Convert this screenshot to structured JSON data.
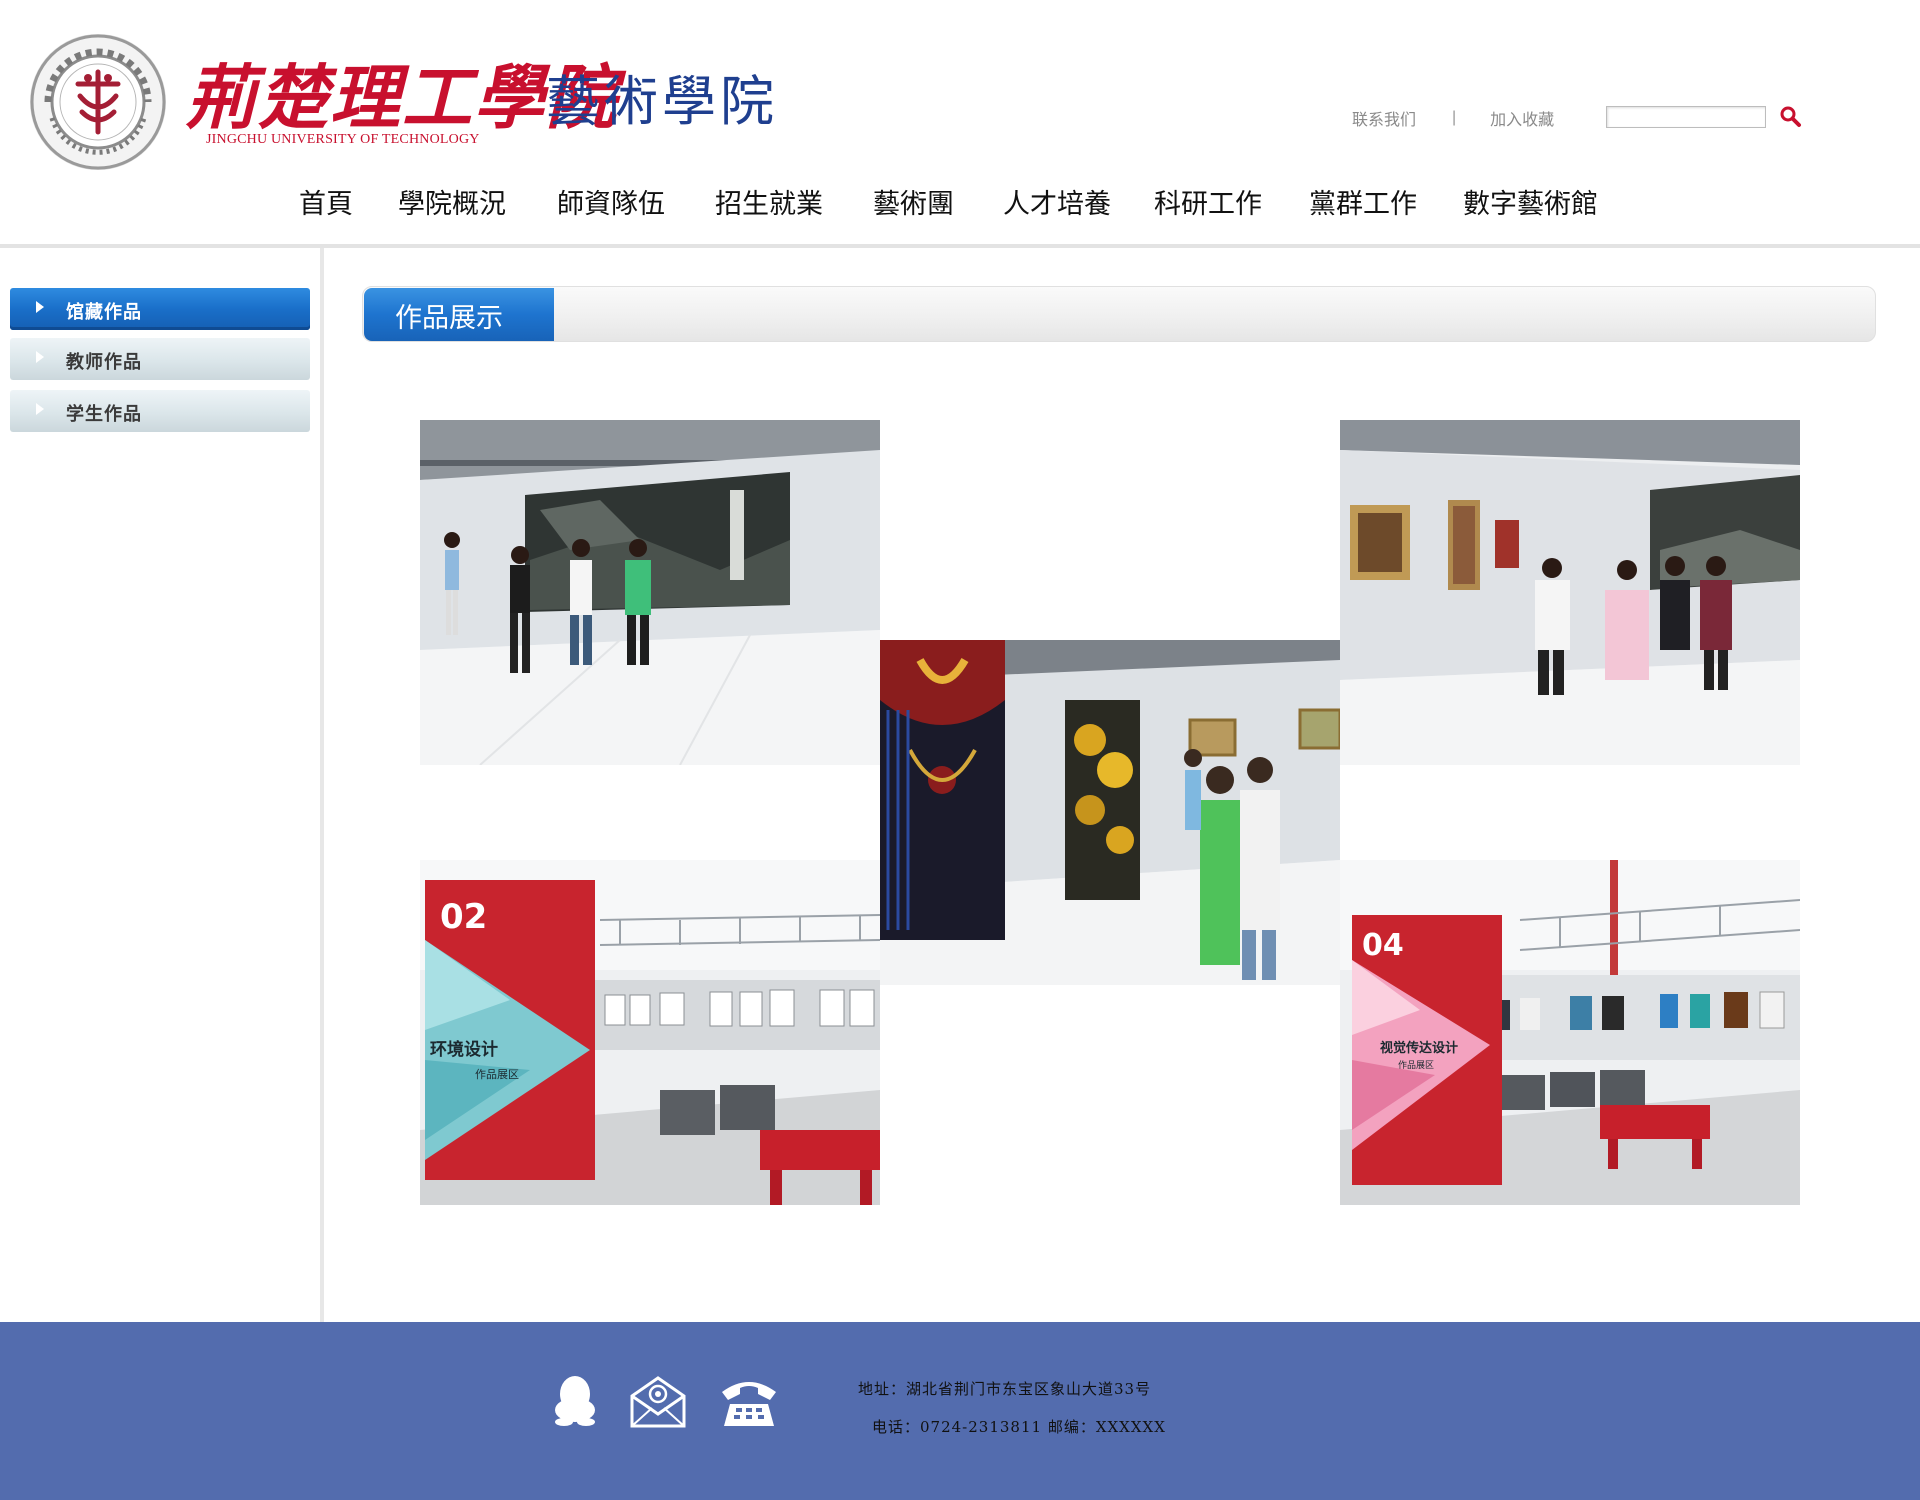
{
  "header": {
    "logo_title": "荊楚理工學院",
    "logo_subtitle": "JINGCHU UNIVERSITY OF TECHNOLOGY",
    "college_name": "藝術學院",
    "links": {
      "contact": "联系我们",
      "separator": "|",
      "favorite": "加入收藏"
    },
    "search": {
      "value": "",
      "placeholder": ""
    },
    "icons": {
      "seal": "university-seal-icon",
      "search": "search-icon"
    }
  },
  "nav": {
    "items": [
      "首頁",
      "學院概況",
      "師資隊伍",
      "招生就業",
      "藝術團",
      "人才培養",
      "科研工作",
      "黨群工作",
      "數字藝術館"
    ]
  },
  "sidebar": {
    "items": [
      {
        "label": "馆藏作品",
        "active": true
      },
      {
        "label": "教师作品",
        "active": false
      },
      {
        "label": "学生作品",
        "active": false
      }
    ]
  },
  "main": {
    "section_title": "作品展示",
    "gallery": {
      "images": [
        {
          "subject": "gallery-landscape-painting-visitors"
        },
        {
          "subject": "gallery-tapestry-exhibition"
        },
        {
          "subject": "gallery-framed-paintings-visitors"
        },
        {
          "subject": "environment-design-exhibit",
          "sign_number": "02",
          "sign_title": "环境设计",
          "sign_sub": "作品展区"
        },
        {
          "subject": "visual-communication-exhibit",
          "sign_number": "04",
          "sign_title": "视觉传达设计",
          "sign_sub": "作品展区"
        }
      ]
    }
  },
  "footer": {
    "address": "地址：湖北省荆门市东宝区象山大道33号",
    "contact": "电话：0724-2313811   邮编：XXXXXX",
    "icons": [
      "qq-icon",
      "email-icon",
      "telephone-icon"
    ]
  },
  "colors": {
    "brand_red": "#c8102e",
    "brand_blue": "#1f3f8f",
    "tab_blue": "#1e74cf",
    "footer_blue": "#536cae"
  }
}
